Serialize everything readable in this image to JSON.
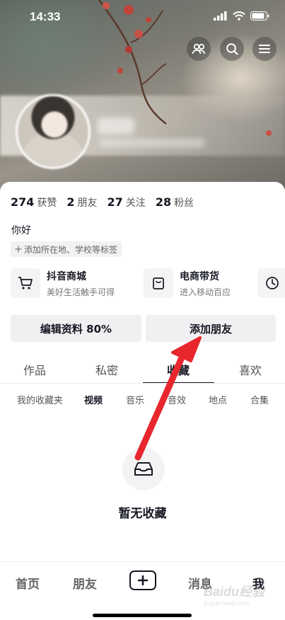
{
  "status_bar": {
    "time": "14:33"
  },
  "header_actions": [
    {
      "icon": "friends-icon"
    },
    {
      "icon": "search-icon"
    },
    {
      "icon": "menu-icon"
    }
  ],
  "profile": {
    "stats": [
      {
        "value": "274",
        "label": "获赞"
      },
      {
        "value": "2",
        "label": "朋友"
      },
      {
        "value": "27",
        "label": "关注"
      },
      {
        "value": "28",
        "label": "粉丝"
      }
    ],
    "bio": "你好",
    "add_tag_label": "添加所在地、学校等标签"
  },
  "shop_entries": [
    {
      "title": "抖音商城",
      "subtitle": "美好生活触手可得",
      "icon": "cart-icon"
    },
    {
      "title": "电商带货",
      "subtitle": "进入移动百应",
      "icon": "bag-icon"
    },
    {
      "title": "",
      "subtitle": "",
      "icon": "clock-icon"
    }
  ],
  "actions": {
    "edit_profile": "编辑资料 80%",
    "add_friend": "添加朋友"
  },
  "tabs": [
    "作品",
    "私密",
    "收藏",
    "喜欢"
  ],
  "active_tab": "收藏",
  "subtabs": [
    "我的收藏夹",
    "视频",
    "音乐",
    "音效",
    "地点",
    "合集"
  ],
  "active_subtab": "视频",
  "empty_state": {
    "text": "暂无收藏",
    "icon": "inbox-icon"
  },
  "bottom_nav": [
    "首页",
    "朋友",
    "消息",
    "我"
  ],
  "active_nav": "我",
  "watermark": {
    "main": "Baidu经验",
    "sub": "jingyan.baidu.com"
  },
  "colors": {
    "annotation_arrow": "#e8262d",
    "text_primary": "#161823"
  }
}
